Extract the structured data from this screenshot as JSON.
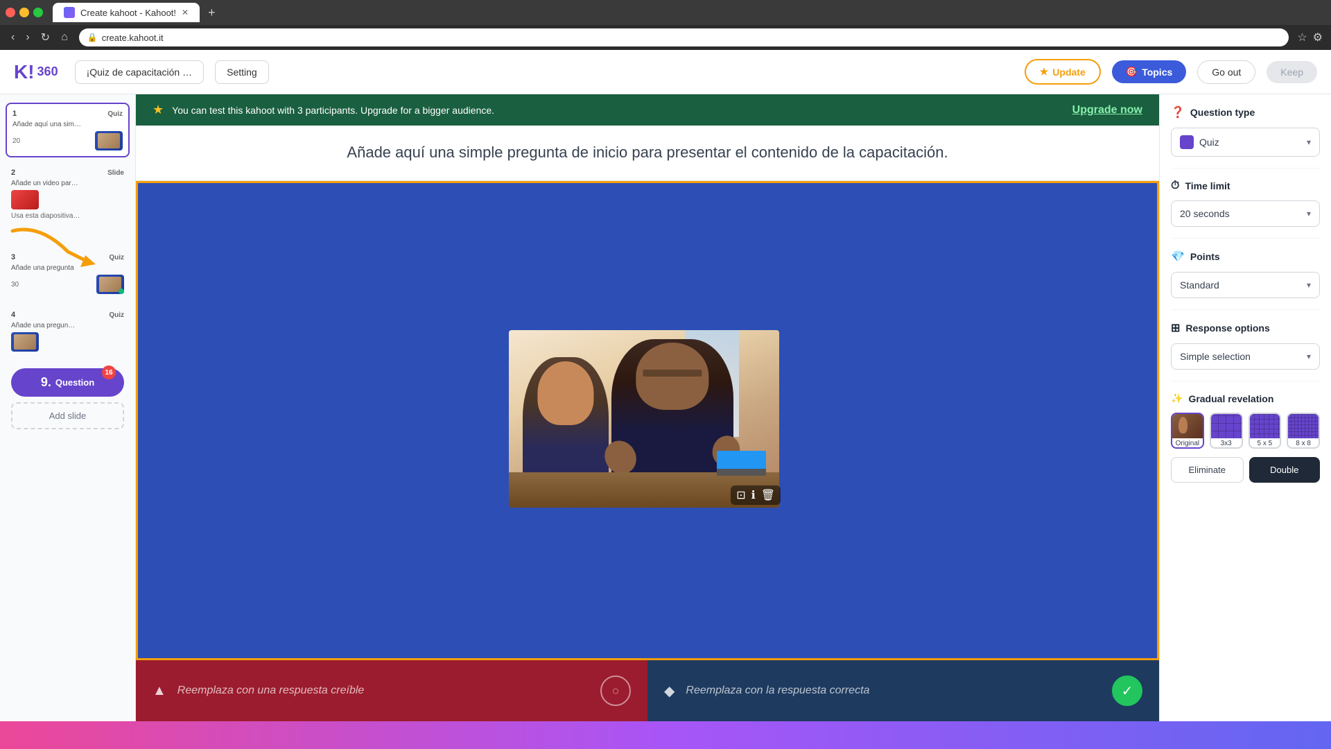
{
  "browser": {
    "tab_label": "Create kahoot - Kahoot!",
    "url": "create.kahoot.it",
    "new_tab": "+"
  },
  "app": {
    "logo": "K!",
    "logo_number": "360",
    "quiz_title": "¡Quiz de capacitación …",
    "setting_label": "Setting",
    "update_label": "Update",
    "topics_label": "Topics",
    "go_out_label": "Go out",
    "keep_label": "Keep"
  },
  "sidebar": {
    "slides": [
      {
        "number": "1",
        "type": "Quiz",
        "title": "Añade aquí una sim…",
        "time": "20",
        "desc": "",
        "active": true,
        "has_dot": false
      },
      {
        "number": "2",
        "type": "Slide",
        "title": "Añade un video par…",
        "time": "",
        "desc": "Usa esta diapositiva…",
        "active": false,
        "has_dot": false
      },
      {
        "number": "3",
        "type": "Quiz",
        "title": "Añade una pregunta",
        "time": "30",
        "desc": "",
        "active": false,
        "has_dot": true
      },
      {
        "number": "4",
        "type": "Quiz",
        "title": "Añade una pregun…",
        "time": "",
        "desc": "",
        "active": false,
        "has_dot": false
      }
    ],
    "add_question_label": "Question",
    "badge_count": "16",
    "add_slide_label": "Add slide"
  },
  "upgrade_banner": {
    "text": "You can test this kahoot with 3 participants. Upgrade for a bigger audience.",
    "link_text": "Upgrade now"
  },
  "question_area": {
    "placeholder": "Añade aquí una simple pregunta de inicio para presentar el contenido de la capacitación."
  },
  "answers": [
    {
      "text": "Reemplaza con una respuesta creíble",
      "type": "wrong",
      "icon": "▲"
    },
    {
      "text": "Reemplaza con la respuesta correcta",
      "type": "correct",
      "icon": "◆"
    }
  ],
  "right_panel": {
    "question_type_label": "Question type",
    "question_type_value": "Quiz",
    "question_type_chevron": "▾",
    "time_limit_label": "Time limit",
    "time_limit_value": "20 seconds",
    "time_limit_chevron": "▾",
    "points_label": "Points",
    "points_value": "Standard",
    "points_chevron": "▾",
    "response_options_label": "Response options",
    "response_options_value": "Simple selection",
    "response_options_chevron": "▾",
    "gradual_label": "Gradual revelation",
    "gradual_options": [
      {
        "label": "Original",
        "type": "original",
        "selected": true
      },
      {
        "label": "3x3",
        "type": "3x3",
        "selected": false
      },
      {
        "label": "5 x 5",
        "type": "5x5",
        "selected": false
      },
      {
        "label": "8 x 8",
        "type": "8x8",
        "selected": false
      }
    ],
    "eliminate_label": "Eliminate",
    "double_label": "Double"
  }
}
